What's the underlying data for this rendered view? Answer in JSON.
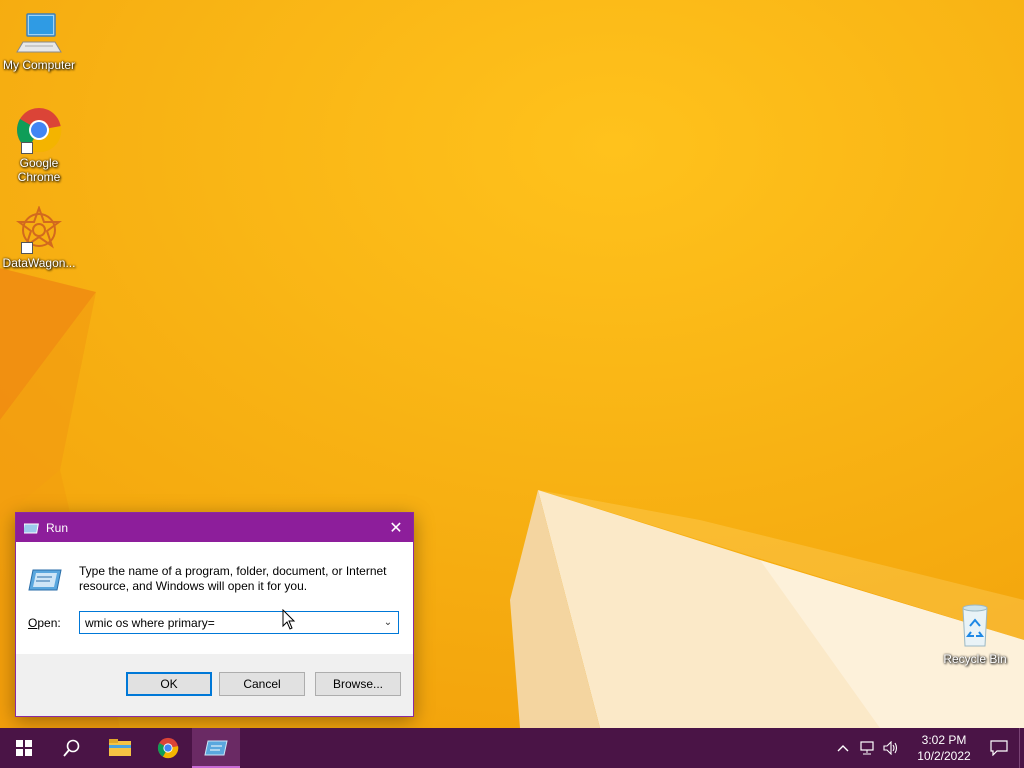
{
  "desktop": {
    "icons": [
      {
        "label": "My Computer",
        "icon": "computer-icon"
      },
      {
        "label": "Google Chrome",
        "icon": "chrome-icon"
      },
      {
        "label": "DataWagon...",
        "icon": "datawagon-icon"
      },
      {
        "label": "Recycle Bin",
        "icon": "recycle-bin-icon"
      }
    ]
  },
  "run_dialog": {
    "title": "Run",
    "description": "Type the name of a program, folder, document, or Internet resource, and Windows will open it for you.",
    "open_label_prefix": "O",
    "open_label_rest": "pen:",
    "open_value": "wmic os where primary=",
    "ok_label": "OK",
    "cancel_label": "Cancel",
    "browse_label": "Browse...",
    "accent_color": "#8d1e9b"
  },
  "taskbar": {
    "items": [
      "start-icon",
      "search-icon",
      "file-explorer-icon",
      "chrome-icon",
      "run-icon"
    ],
    "clock_time": "3:02 PM",
    "clock_date": "10/2/2022",
    "color": "#4a1446"
  }
}
